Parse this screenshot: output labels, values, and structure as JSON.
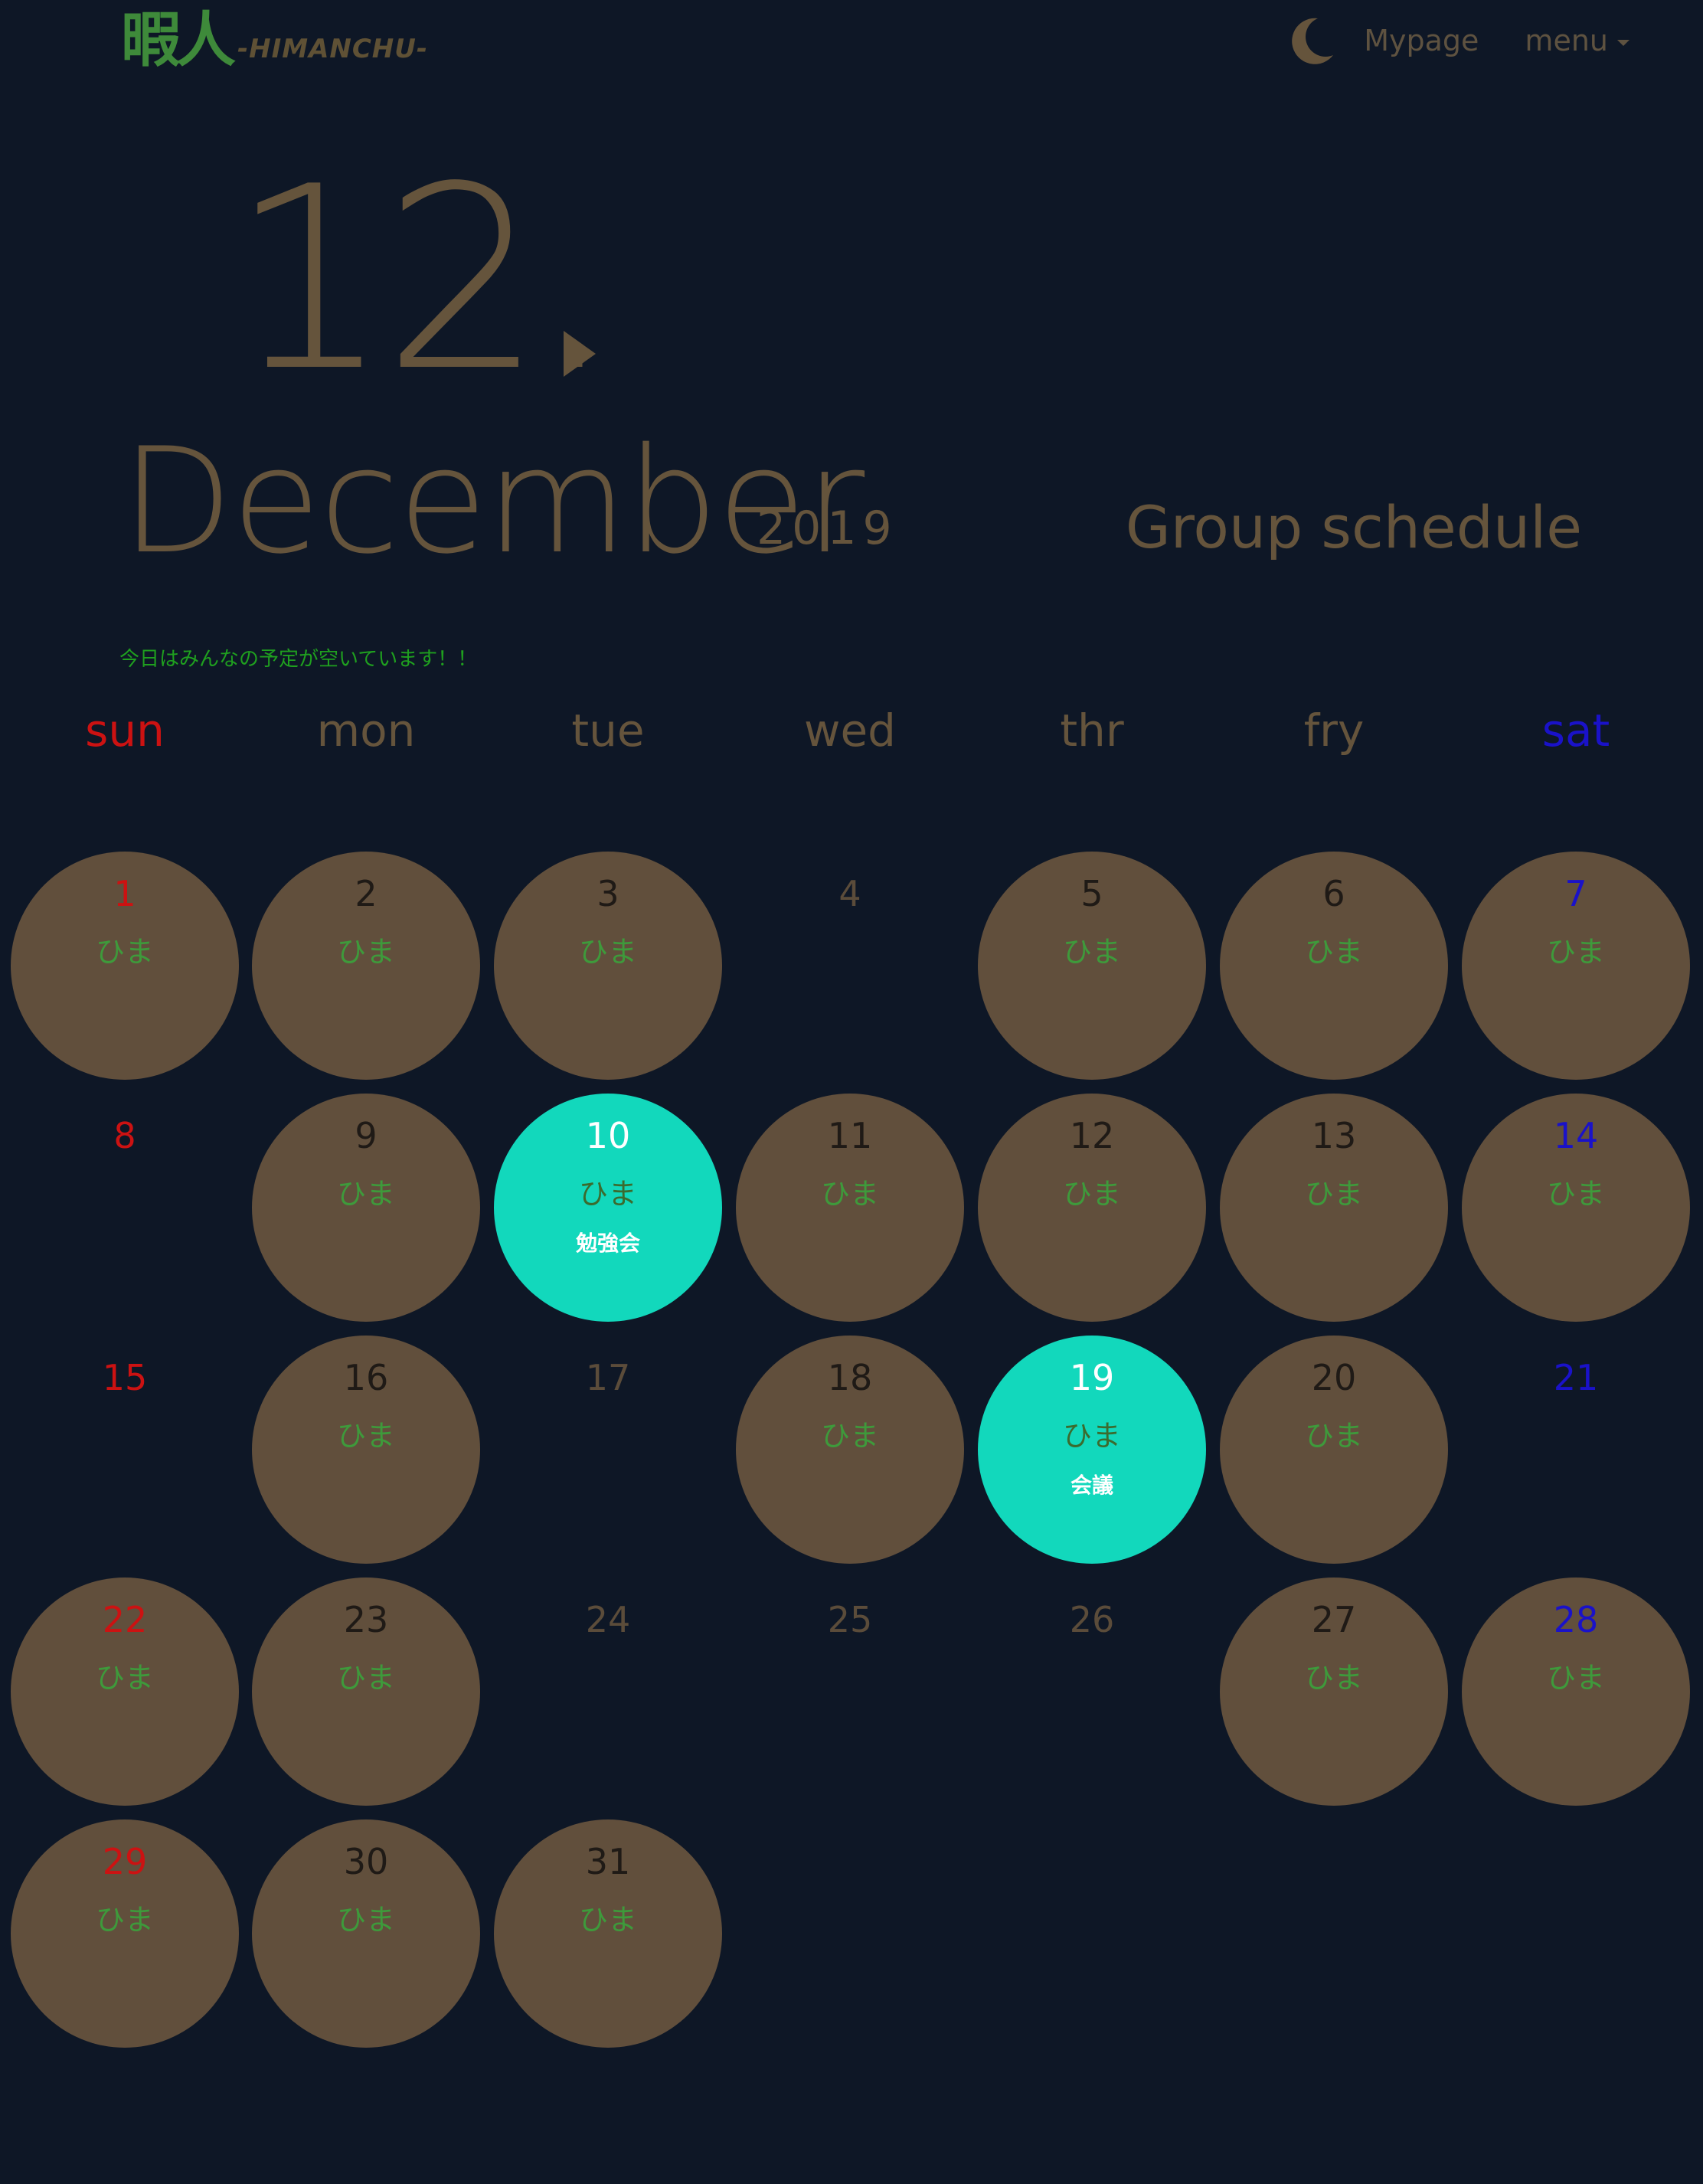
{
  "header": {
    "logo_kanji": "暇人",
    "logo_text": "-HIMANCHU-",
    "mypage_label": "Mypage",
    "menu_label": "menu",
    "theme_icon": "moon-icon"
  },
  "calendar": {
    "month_number": "12.",
    "month_name": "December",
    "year": "2019",
    "title": "Group schedule",
    "today_message": "今日はみんなの予定が空いています！！",
    "weekdays": [
      "sun",
      "mon",
      "tue",
      "wed",
      "thr",
      "fry",
      "sat"
    ],
    "free_label": "ひま",
    "days": [
      {
        "day": "1",
        "status": "free"
      },
      {
        "day": "2",
        "status": "free"
      },
      {
        "day": "3",
        "status": "free"
      },
      {
        "day": "4",
        "status": "busy"
      },
      {
        "day": "5",
        "status": "free"
      },
      {
        "day": "6",
        "status": "free"
      },
      {
        "day": "7",
        "status": "free"
      },
      {
        "day": "8",
        "status": "busy"
      },
      {
        "day": "9",
        "status": "free"
      },
      {
        "day": "10",
        "status": "event",
        "event": "勉強会"
      },
      {
        "day": "11",
        "status": "free"
      },
      {
        "day": "12",
        "status": "free"
      },
      {
        "day": "13",
        "status": "free"
      },
      {
        "day": "14",
        "status": "free"
      },
      {
        "day": "15",
        "status": "busy"
      },
      {
        "day": "16",
        "status": "free"
      },
      {
        "day": "17",
        "status": "busy"
      },
      {
        "day": "18",
        "status": "free"
      },
      {
        "day": "19",
        "status": "event",
        "event": "会議"
      },
      {
        "day": "20",
        "status": "free"
      },
      {
        "day": "21",
        "status": "busy"
      },
      {
        "day": "22",
        "status": "free"
      },
      {
        "day": "23",
        "status": "free"
      },
      {
        "day": "24",
        "status": "busy"
      },
      {
        "day": "25",
        "status": "busy"
      },
      {
        "day": "26",
        "status": "busy"
      },
      {
        "day": "27",
        "status": "free"
      },
      {
        "day": "28",
        "status": "free"
      },
      {
        "day": "29",
        "status": "free"
      },
      {
        "day": "30",
        "status": "free"
      },
      {
        "day": "31",
        "status": "free"
      }
    ]
  },
  "colors": {
    "background": "#0e1726",
    "free_circle": "#614f3c",
    "event_circle": "#12d8bc",
    "accent_text": "#65543c",
    "sunday": "#cc1212",
    "saturday": "#1a12c9",
    "free_text": "#3e9a3b"
  }
}
